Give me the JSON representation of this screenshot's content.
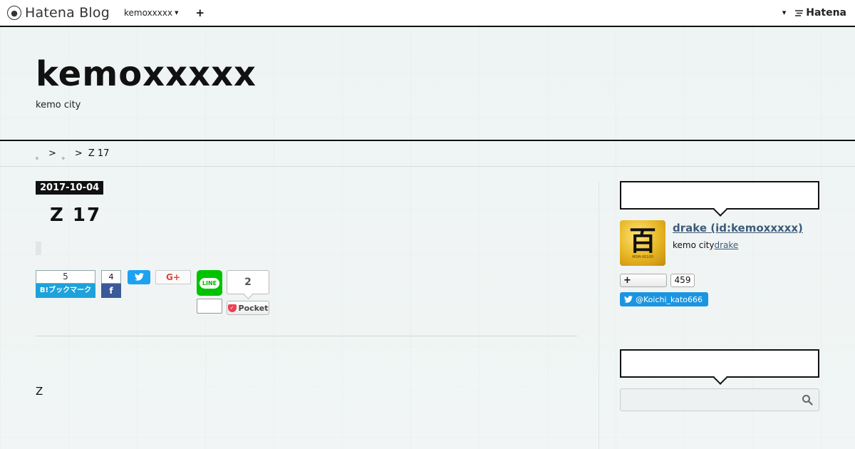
{
  "topbar": {
    "brand": "Hatena Blog",
    "blog_selector": "kemoxxxxx",
    "plus": "+",
    "right_logo": "Hatena",
    "icons": [
      "hatena-blog-logo-icon",
      "caret-icon",
      "plus-icon",
      "hatena-logo-icon"
    ]
  },
  "header": {
    "title": "kemoxxxxx",
    "description": "kemo city"
  },
  "breadcrumb": {
    "items": [
      "。",
      "。"
    ],
    "separator": ">",
    "current": "Z  17"
  },
  "entry": {
    "date": "2017-10-04",
    "title": "Z  17",
    "body_line_1": "Z",
    "body_line_2": "…"
  },
  "share": {
    "hatena_count": "5",
    "hatena_label": "B!ブックマーク",
    "facebook_count": "4",
    "facebook_label": "f",
    "twitter_label": "•",
    "google_label": "G+",
    "line_label": "LINE",
    "pocket_count": "2",
    "pocket_label": "Pocket"
  },
  "sidebar": {
    "profile_name": "drake (id:kemoxxxxx)",
    "profile_desc": "kemo city",
    "profile_link": "drake",
    "avatar_glyph": "百",
    "avatar_sub": "MSM-00100",
    "follow_label": "+",
    "follow_count": "459",
    "twitter_follow": "@Koichi_kato666"
  },
  "colors": {
    "accent": "#111111",
    "link": "#3d5b78",
    "hatena_blue": "#1ea2db",
    "facebook": "#3b5998",
    "twitter": "#1da1f2",
    "line": "#00c300",
    "pocket": "#ef4056"
  }
}
